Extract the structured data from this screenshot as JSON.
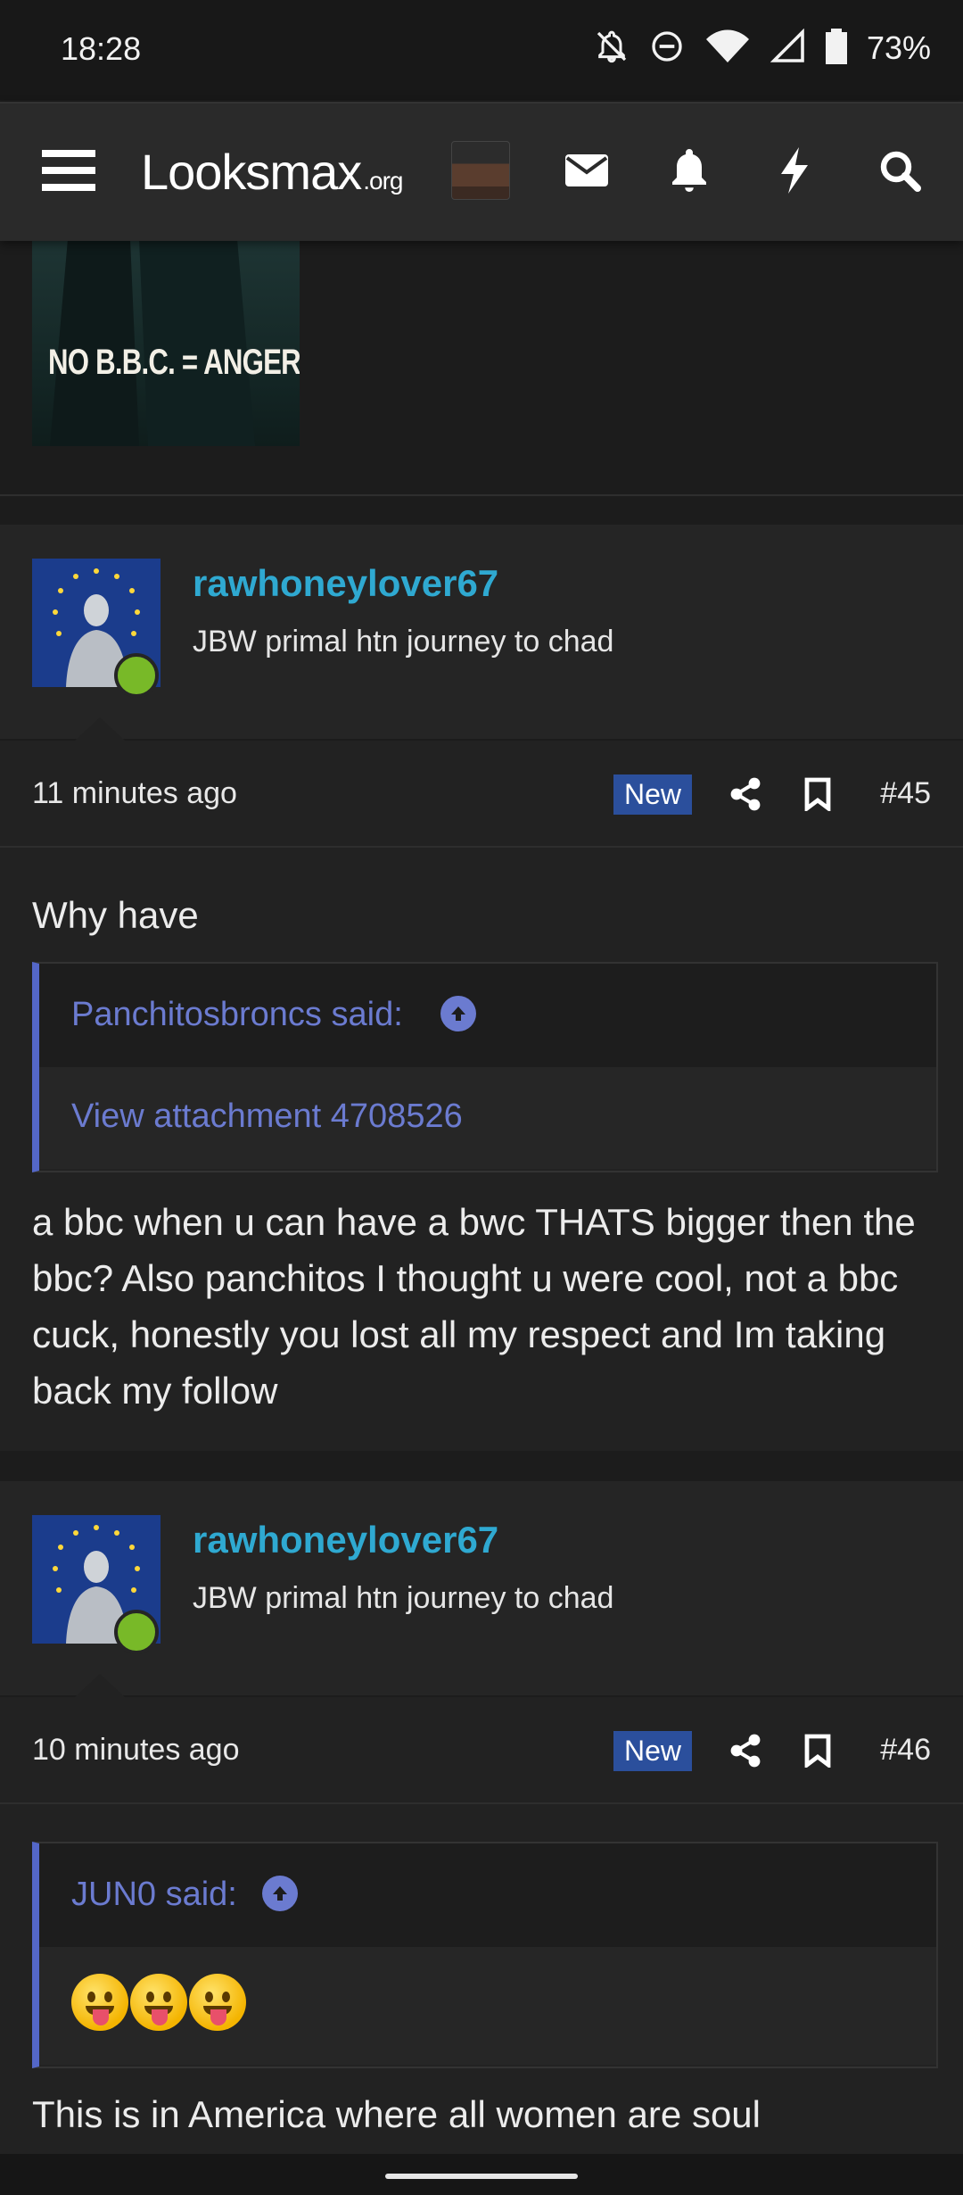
{
  "status_bar": {
    "time": "18:28",
    "battery_percent": "73%",
    "icons": [
      "bell-off-icon",
      "dnd-icon",
      "wifi-icon",
      "signal-icon",
      "battery-icon"
    ]
  },
  "header": {
    "logo_main": "Looksmax",
    "logo_suffix": ".org",
    "icons": [
      "menu-icon",
      "avatar",
      "mail-icon",
      "bell-icon",
      "bolt-icon",
      "search-icon"
    ]
  },
  "previous_post": {
    "image_text": "NO B.B.C. = ANGER"
  },
  "posts": [
    {
      "username": "rawhoneylover67",
      "user_title": "JBW primal htn journey to chad",
      "time": "11 minutes ago",
      "badge": "New",
      "number": "#45",
      "text_before": "Why have",
      "quote_author": "Panchitosbroncs said:",
      "quote_content": "View attachment 4708526",
      "text_after": "a bbc when u can have a bwc THATS bigger then the bbc? Also panchitos I thought u were cool, not a bbc cuck, honestly you lost all my respect and Im taking back my follow"
    },
    {
      "username": "rawhoneylover67",
      "user_title": "JBW primal htn journey to chad",
      "time": "10 minutes ago",
      "badge": "New",
      "number": "#46",
      "quote_author": "JUN0 said:",
      "quote_emojis": [
        "😛",
        "😛",
        "😛"
      ],
      "text_after": "This is in America where all women are soul"
    }
  ],
  "colors": {
    "username": "#2fa9d1",
    "badge": "#2b4f9c",
    "quote_accent": "#5467c8",
    "online": "#78b928"
  }
}
